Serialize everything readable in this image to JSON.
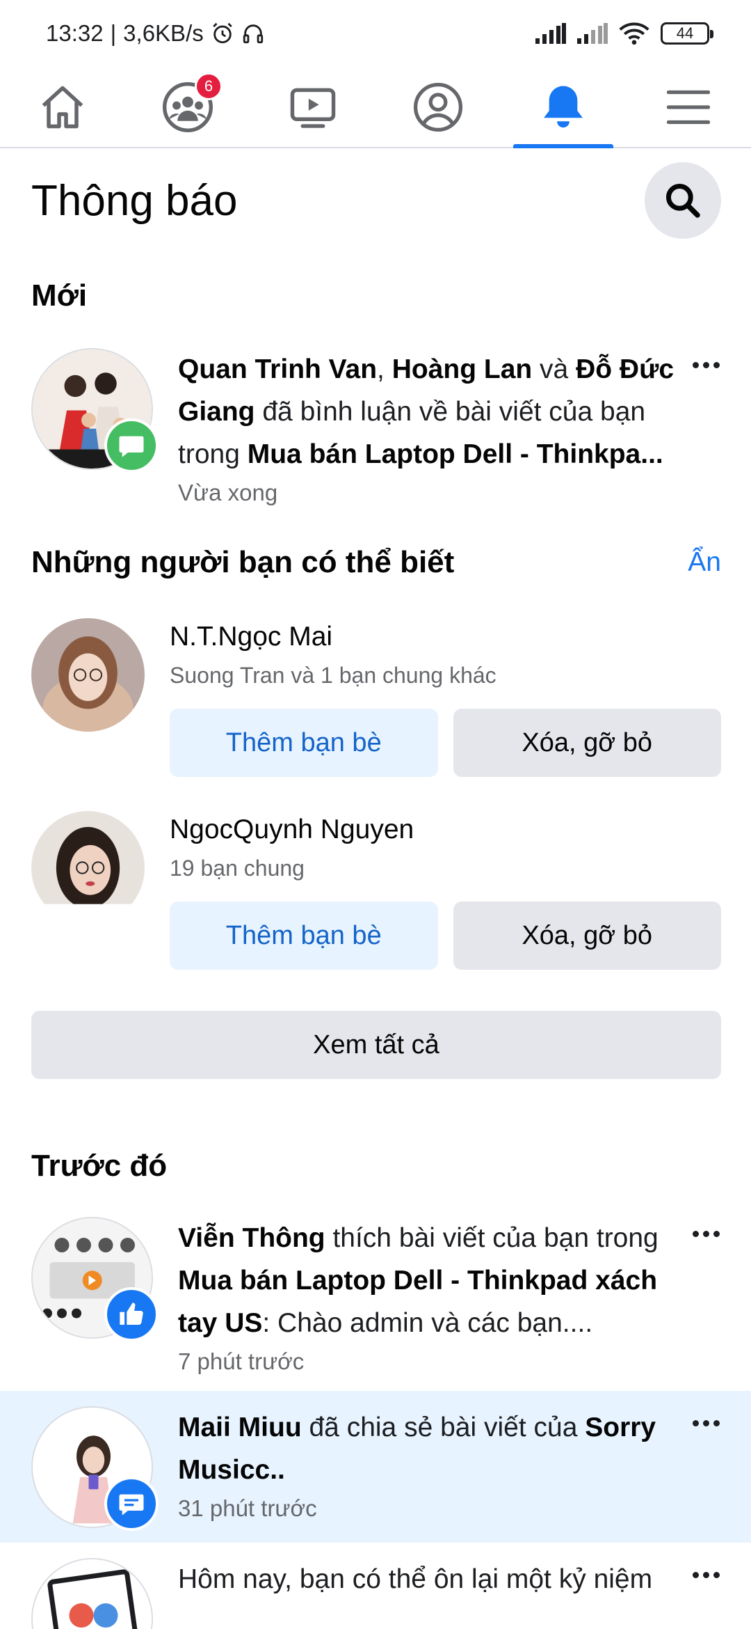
{
  "status_bar": {
    "time": "13:32",
    "separator": "|",
    "speed": "3,6KB/s",
    "battery": "44"
  },
  "nav": {
    "tabs": [
      {
        "name": "home",
        "icon": "home-icon"
      },
      {
        "name": "groups",
        "icon": "groups-icon",
        "badge": "6"
      },
      {
        "name": "watch",
        "icon": "video-icon"
      },
      {
        "name": "profile",
        "icon": "profile-icon"
      },
      {
        "name": "notifications",
        "icon": "bell-icon",
        "active": true
      },
      {
        "name": "menu",
        "icon": "menu-icon"
      }
    ]
  },
  "header": {
    "title": "Thông báo"
  },
  "sections": {
    "new": "Mới",
    "earlier": "Trước đó"
  },
  "notifications": {
    "n1": {
      "actor1": "Quan Trinh Van",
      "sep1": ", ",
      "actor2": "Hoàng Lan",
      "and": " và ",
      "actor3": "Đỗ Đức Giang",
      "action": " đã bình luận về bài viết của bạn trong ",
      "group": "Mua bán Laptop Dell - Thinkpa...",
      "time": "Vừa xong",
      "badge": "comment-icon"
    },
    "n2": {
      "actor": "Viễn Thông",
      "action": " thích bài viết của bạn trong ",
      "group": "Mua bán Laptop Dell - Thinkpad xách tay US",
      "snippet": ": Chào admin và các bạn....",
      "time": "7 phút trước",
      "badge": "like-icon"
    },
    "n3": {
      "actor": "Maii Miuu",
      "action": " đã chia sẻ bài viết của ",
      "target": "Sorry Musicc..",
      "time": "31 phút trước",
      "badge": "share-icon"
    },
    "n4": {
      "text": "Hôm nay, bạn có thể ôn lại một kỷ niệm"
    }
  },
  "pymk": {
    "title": "Những người bạn có thể biết",
    "hide": "Ẩn",
    "people": [
      {
        "name": "N.T.Ngọc Mai",
        "mutual": "Suong Tran và 1 bạn chung khác",
        "add": "Thêm bạn bè",
        "remove": "Xóa, gỡ bỏ"
      },
      {
        "name": "NgocQuynh Nguyen",
        "mutual": "19 bạn chung",
        "add": "Thêm bạn bè",
        "remove": "Xóa, gỡ bỏ"
      }
    ],
    "see_all": "Xem tất cả"
  },
  "colors": {
    "accent": "#1877f2",
    "unread_bg": "#e7f3ff",
    "badge_red": "#e41e3f",
    "like": "#1877f2",
    "comment": "#45bd62",
    "share": "#1877f2"
  }
}
